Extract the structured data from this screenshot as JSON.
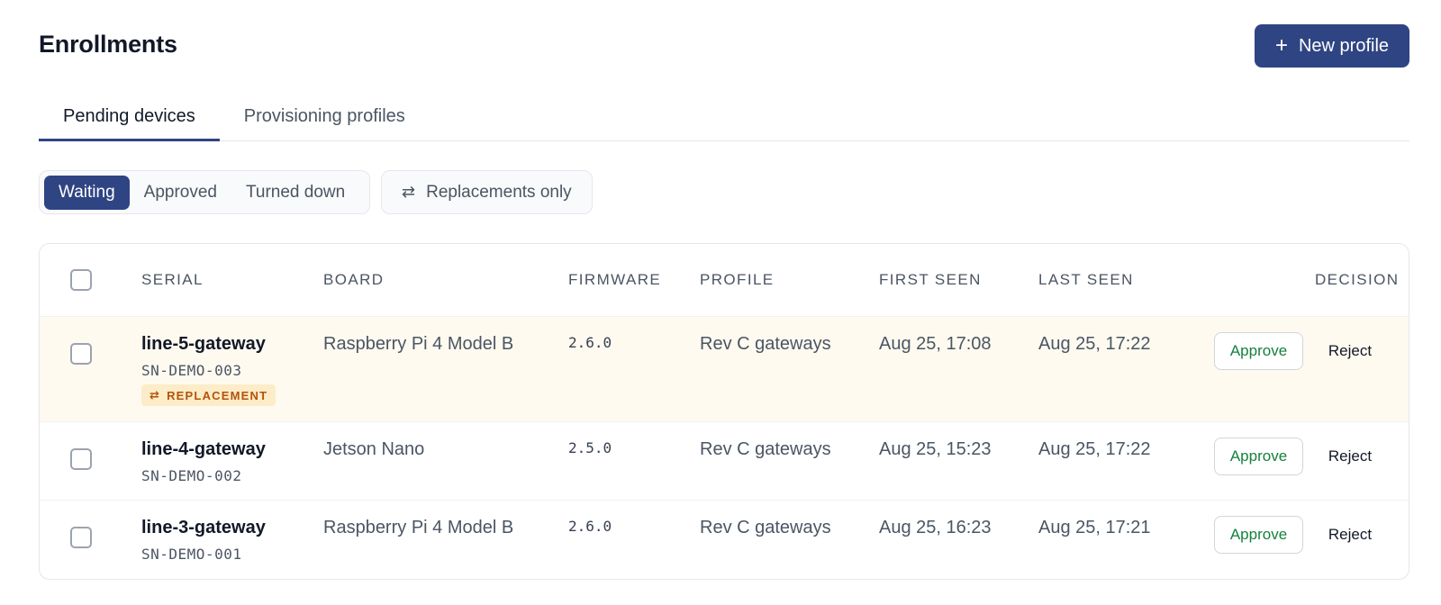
{
  "header": {
    "title": "Enrollments",
    "new_profile_label": "New profile",
    "new_profile_icon": "plus-icon"
  },
  "tabs": [
    {
      "label": "Pending devices",
      "active": true
    },
    {
      "label": "Provisioning profiles",
      "active": false
    }
  ],
  "status_filter": {
    "options": [
      {
        "label": "Waiting",
        "active": true
      },
      {
        "label": "Approved",
        "active": false
      },
      {
        "label": "Turned down",
        "active": false
      }
    ]
  },
  "replacements_filter": {
    "label": "Replacements only",
    "icon": "swap-arrows-icon"
  },
  "table": {
    "columns": {
      "serial": "SERIAL",
      "board": "BOARD",
      "firmware": "FIRMWARE",
      "profile": "PROFILE",
      "first_seen": "FIRST SEEN",
      "last_seen": "LAST SEEN",
      "decision": "DECISION"
    },
    "approve_label": "Approve",
    "reject_label": "Reject",
    "rows": [
      {
        "name": "line-5-gateway",
        "serial": "SN-DEMO-003",
        "badge": "REPLACEMENT",
        "board": "Raspberry Pi 4 Model B",
        "firmware": "2.6.0",
        "profile": "Rev C gateways",
        "first_seen": "Aug 25, 17:08",
        "last_seen": "Aug 25, 17:22"
      },
      {
        "name": "line-4-gateway",
        "serial": "SN-DEMO-002",
        "board": "Jetson Nano",
        "firmware": "2.5.0",
        "profile": "Rev C gateways",
        "first_seen": "Aug 25, 15:23",
        "last_seen": "Aug 25, 17:22"
      },
      {
        "name": "line-3-gateway",
        "serial": "SN-DEMO-001",
        "board": "Raspberry Pi 4 Model B",
        "firmware": "2.6.0",
        "profile": "Rev C gateways",
        "first_seen": "Aug 25, 16:23",
        "last_seen": "Aug 25, 17:21"
      }
    ]
  },
  "colors": {
    "accent": "#2f4483",
    "highlight_row": "#fefaf0",
    "badge_bg": "#fdecc8",
    "badge_text": "#b45309",
    "approve_text": "#15803d"
  }
}
